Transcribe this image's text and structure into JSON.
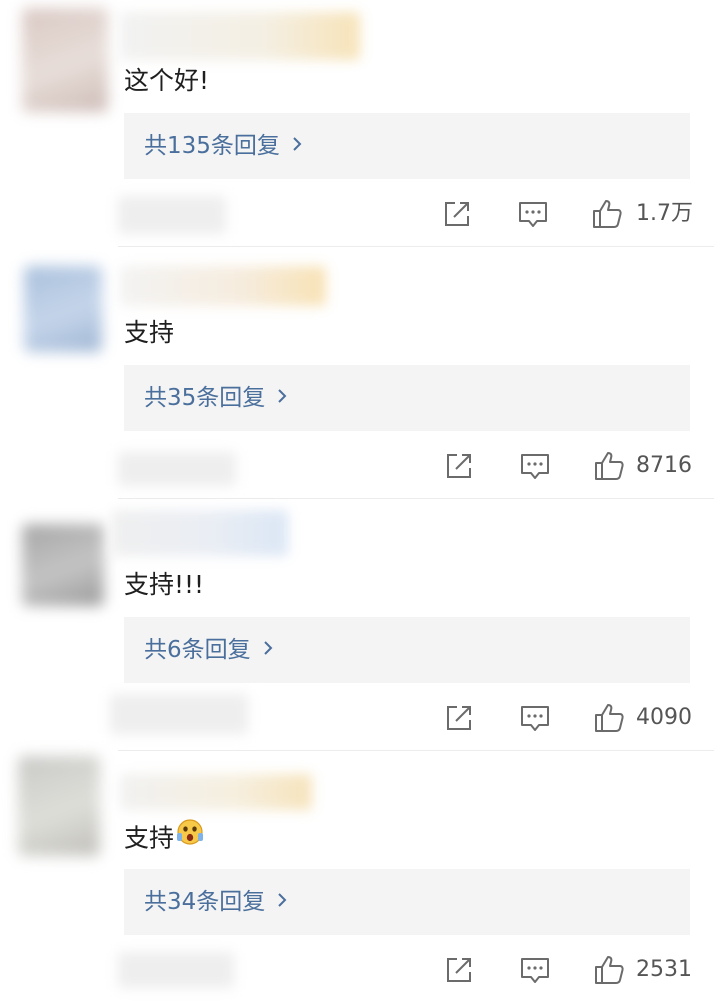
{
  "comments": [
    {
      "text": "这个好!",
      "replies_label": "共135条回复",
      "likes": "1.7万"
    },
    {
      "text": "支持",
      "replies_label": "共35条回复",
      "likes": "8716"
    },
    {
      "text": "支持!!!",
      "replies_label": "共6条回复",
      "likes": "4090"
    },
    {
      "text": "支持",
      "emoji_icon": "surprised-emoji-icon",
      "replies_label": "共34条回复",
      "likes": "2531"
    }
  ],
  "colors": {
    "reply_link": "#4a6f9c",
    "reply_background": "#f4f4f4",
    "icon_stroke": "#6b6b6b"
  },
  "icons": [
    "share-icon",
    "reply-icon",
    "like-icon",
    "chevron-right-icon"
  ]
}
